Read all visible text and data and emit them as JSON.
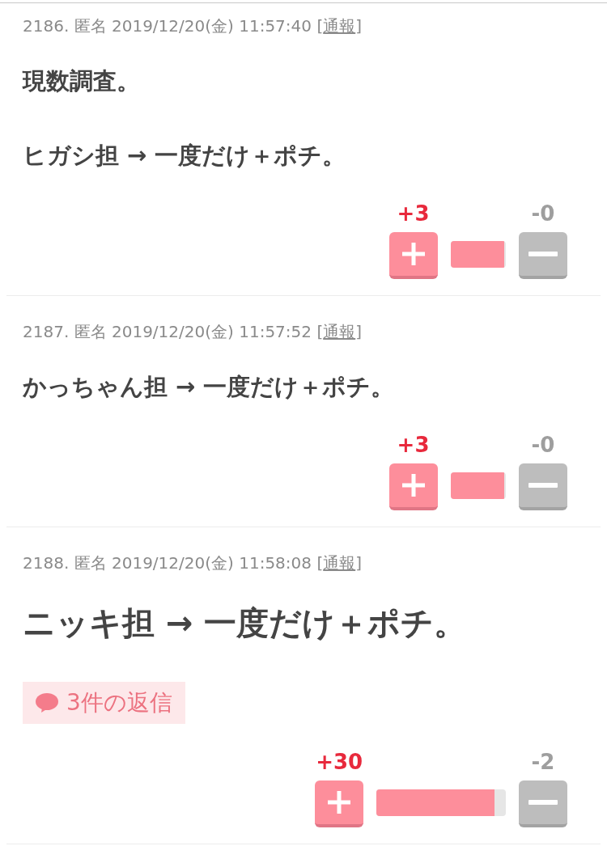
{
  "posts": [
    {
      "header": "2186. 匿名 2019/12/20(金) 11:57:40",
      "report": {
        "open": "[",
        "label": "通報",
        "close": "]"
      },
      "body": [
        "現数調査。",
        "ヒガシ担 → 一度だけ＋ポチ。"
      ],
      "votes": {
        "plus": "+3",
        "minus": "-0",
        "level": 0.97
      }
    },
    {
      "header": "2187. 匿名 2019/12/20(金) 11:57:52",
      "report": {
        "open": "[",
        "label": "通報",
        "close": "]"
      },
      "body": [
        "かっちゃん担 → 一度だけ＋ポチ。"
      ],
      "votes": {
        "plus": "+3",
        "minus": "-0",
        "level": 0.97
      }
    },
    {
      "header": "2188. 匿名 2019/12/20(金) 11:58:08",
      "report": {
        "open": "[",
        "label": "通報",
        "close": "]"
      },
      "body": [
        "ニッキ担 → 一度だけ＋ポチ。"
      ],
      "replies": "3件の返信",
      "votes": {
        "plus": "+30",
        "minus": "-2",
        "level": 0.91
      }
    }
  ]
}
